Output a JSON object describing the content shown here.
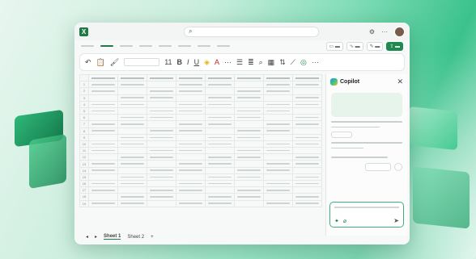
{
  "app": {
    "logo_text": "X"
  },
  "copilot": {
    "title": "Copilot",
    "close_glyph": "✕"
  },
  "sheets": {
    "tabs": [
      "Sheet 1",
      "Sheet 2"
    ],
    "add_glyph": "+"
  },
  "toolbar": {
    "font_size": "11",
    "bold": "B",
    "italic": "I",
    "underline": "U"
  },
  "rows": [
    "1",
    "2",
    "3",
    "4",
    "5",
    "6",
    "7",
    "8",
    "9",
    "10",
    "11",
    "12",
    "13",
    "14",
    "15",
    "16",
    "17",
    "18",
    "19"
  ],
  "colors": {
    "brand": "#1f7a45",
    "copilot_input_border": "#3bb27a"
  }
}
